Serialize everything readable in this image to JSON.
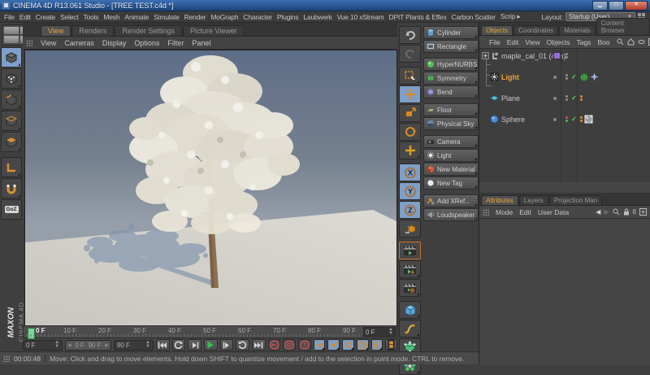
{
  "window": {
    "title": "CINEMA 4D R13.061 Studio - [TREE TEST.c4d *]"
  },
  "menubar": {
    "items": [
      "File",
      "Edit",
      "Create",
      "Select",
      "Tools",
      "Mesh",
      "Animate",
      "Simulate",
      "Render",
      "MoGraph",
      "Character",
      "Plugins",
      "Laubwerk",
      "Vue 10 xStream",
      "DPIT Plants & Effex",
      "Carbon Scatter",
      "Scrip"
    ],
    "layout_label": "Layout:",
    "layout_value": "Startup (User)"
  },
  "workspace_tabs": {
    "items": [
      "View",
      "Renders",
      "Render Settings",
      "Picture Viewer"
    ],
    "active": "View"
  },
  "viewport_menu": {
    "items": [
      "View",
      "Cameras",
      "Display",
      "Options",
      "Filter",
      "Panel"
    ]
  },
  "command_palette": {
    "items": [
      {
        "label": "Cylinder"
      },
      {
        "label": "Rectangle"
      },
      {
        "label": "HyperNURBS"
      },
      {
        "label": "Symmetry"
      },
      {
        "label": "Bend"
      },
      {
        "label": "Floor"
      },
      {
        "label": "Physical Sky"
      },
      {
        "label": "Camera"
      },
      {
        "label": "Light"
      },
      {
        "label": "New Material"
      },
      {
        "label": "New Tag"
      },
      {
        "label": "Add XRef..."
      },
      {
        "label": "Loudspeaker"
      }
    ]
  },
  "objects_panel": {
    "tabs": [
      "Objects",
      "Coordinates",
      "Materials",
      "Content Browser"
    ],
    "active_tab": "Objects",
    "menu": [
      "File",
      "Edit",
      "View",
      "Objects",
      "Tags",
      "Boo"
    ],
    "tree": [
      {
        "name": "maple_cal_01 (4 m)",
        "selected": false
      },
      {
        "name": "Light",
        "selected": true
      },
      {
        "name": "Plane",
        "selected": false
      },
      {
        "name": "Sphere",
        "selected": false
      }
    ]
  },
  "attributes_panel": {
    "tabs": [
      "Attributes",
      "Layers",
      "Projection Man"
    ],
    "active_tab": "Attributes",
    "menu": [
      "Mode",
      "Edit",
      "User Data"
    ]
  },
  "timeline": {
    "ticks": [
      "0 F",
      "10 F",
      "20 F",
      "30 F",
      "40 F",
      "50 F",
      "60 F",
      "70 F",
      "80 F",
      "90 F"
    ],
    "current_frame": "0 F",
    "start_frame": "0 F",
    "range_start": "0 F",
    "range_end": "90 F",
    "end_frame": "90 F"
  },
  "statusbar": {
    "timecode": "00:00:48",
    "message": "Move: Click and drag to move elements. Hold down SHIFT to quantize movement / add to the selection in point mode. CTRL to remove."
  },
  "branding": {
    "maxon": "MAXON",
    "cinema": "CINEMA 4D"
  },
  "colors": {
    "accent_orange": "#e8a33d",
    "selection_blue": "#7d9fc8",
    "record_red": "#c85050",
    "play_green": "#35c24c"
  }
}
